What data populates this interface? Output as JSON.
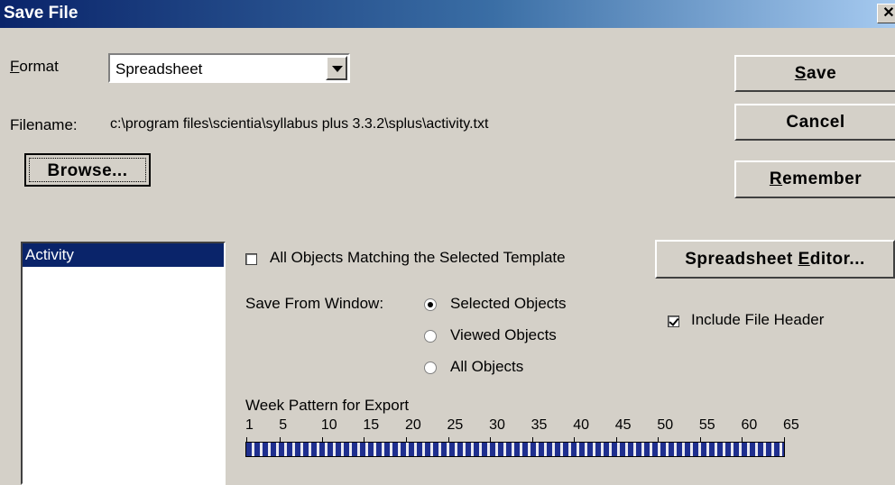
{
  "window": {
    "title": "Save File",
    "close_glyph": "✕"
  },
  "format": {
    "label_first": "F",
    "label_rest": "ormat",
    "value": "Spreadsheet"
  },
  "filename": {
    "label": "Filename:",
    "value": "c:\\program files\\scientia\\syllabus plus 3.3.2\\splus\\activity.txt"
  },
  "buttons": {
    "browse": "Browse...",
    "save_ul": "S",
    "save_rest": "ave",
    "cancel": "Cancel",
    "remember_ul": "R",
    "remember_rest": "emember",
    "editor_pre": "Spreadsheet ",
    "editor_ul": "E",
    "editor_post": "ditor..."
  },
  "list": {
    "items": [
      "Activity"
    ]
  },
  "options": {
    "all_matching": {
      "label": "All Objects Matching the Selected Template",
      "checked": false
    },
    "include_header": {
      "label": "Include File Header",
      "checked": true
    }
  },
  "save_from": {
    "label": "Save From Window:",
    "options": [
      "Selected Objects",
      "Viewed Objects",
      "All Objects"
    ],
    "selected": "Selected Objects"
  },
  "week_pattern": {
    "label": "Week Pattern for Export",
    "ticks": [
      "1",
      "5",
      "10",
      "15",
      "20",
      "25",
      "30",
      "35",
      "40",
      "45",
      "50",
      "55",
      "60",
      "65"
    ]
  }
}
